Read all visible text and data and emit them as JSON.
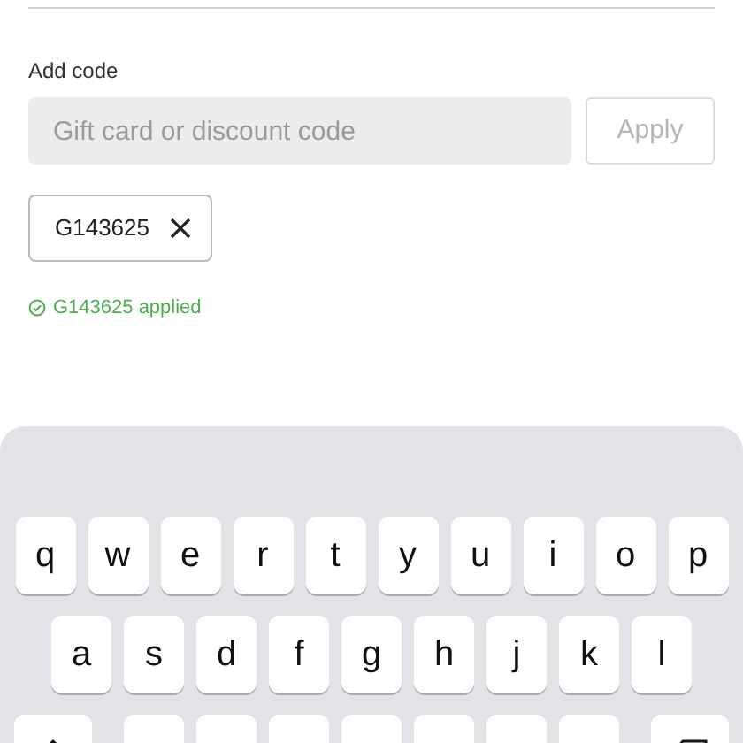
{
  "code_form": {
    "label": "Add code",
    "input": {
      "placeholder": "Gift card or discount code"
    },
    "apply_button": {
      "label": "Apply",
      "disabled": true
    },
    "applied_codes": [
      {
        "code": "G143625"
      }
    ],
    "status": {
      "kind": "success",
      "text": "G143625 applied"
    }
  },
  "keyboard": {
    "rows": [
      [
        {
          "kind": "letter",
          "label": "q"
        },
        {
          "kind": "letter",
          "label": "w"
        },
        {
          "kind": "letter",
          "label": "e"
        },
        {
          "kind": "letter",
          "label": "r"
        },
        {
          "kind": "letter",
          "label": "t"
        },
        {
          "kind": "letter",
          "label": "y"
        },
        {
          "kind": "letter",
          "label": "u"
        },
        {
          "kind": "letter",
          "label": "i"
        },
        {
          "kind": "letter",
          "label": "o"
        },
        {
          "kind": "letter",
          "label": "p"
        }
      ],
      [
        {
          "kind": "letter",
          "label": "a"
        },
        {
          "kind": "letter",
          "label": "s"
        },
        {
          "kind": "letter",
          "label": "d"
        },
        {
          "kind": "letter",
          "label": "f"
        },
        {
          "kind": "letter",
          "label": "g"
        },
        {
          "kind": "letter",
          "label": "h"
        },
        {
          "kind": "letter",
          "label": "j"
        },
        {
          "kind": "letter",
          "label": "k"
        },
        {
          "kind": "letter",
          "label": "l"
        }
      ],
      [
        {
          "kind": "shift"
        },
        {
          "kind": "letter"
        },
        {
          "kind": "letter"
        },
        {
          "kind": "letter"
        },
        {
          "kind": "letter"
        },
        {
          "kind": "letter"
        },
        {
          "kind": "letter"
        },
        {
          "kind": "letter"
        },
        {
          "kind": "delete"
        }
      ]
    ]
  }
}
